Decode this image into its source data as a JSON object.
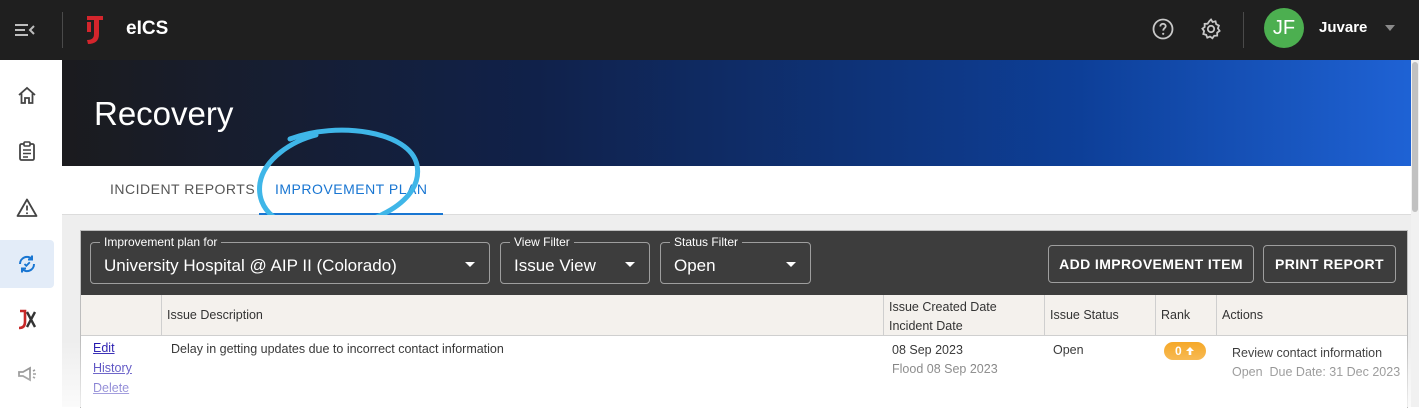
{
  "app": {
    "name": "eICS"
  },
  "user": {
    "initials": "JF",
    "name": "Juvare"
  },
  "header": {
    "title": "Recovery"
  },
  "tabs": [
    {
      "label": "INCIDENT REPORTS",
      "active": false
    },
    {
      "label": "IMPROVEMENT PLAN",
      "active": true
    }
  ],
  "filters": {
    "plan": {
      "legend": "Improvement plan for",
      "value": "University Hospital @ AIP  II (Colorado)"
    },
    "view": {
      "legend": "View Filter",
      "value": "Issue View"
    },
    "status": {
      "legend": "Status Filter",
      "value": "Open"
    }
  },
  "buttons": {
    "add": "ADD IMPROVEMENT ITEM",
    "print": "PRINT REPORT"
  },
  "table": {
    "headers": {
      "description": "Issue Description",
      "created": "Issue Created Date",
      "incident": "Incident Date",
      "status": "Issue Status",
      "rank": "Rank",
      "actions": "Actions"
    },
    "rows": [
      {
        "links": {
          "edit": "Edit",
          "history": "History",
          "delete": "Delete"
        },
        "description": "Delay in getting updates due to incorrect contact information",
        "created_date": "08 Sep 2023",
        "incident": "Flood 08 Sep 2023",
        "status": "Open",
        "rank": "0",
        "action_title": "Review contact information",
        "action_meta": "Open  Due Date: 31 Dec 2023"
      }
    ]
  },
  "colors": {
    "accent": "#1976d2",
    "topbar": "#1f1f1f",
    "avatar": "#4caf50",
    "rank_badge": "#f5a623",
    "highlight_circle": "#3fb6e8"
  }
}
